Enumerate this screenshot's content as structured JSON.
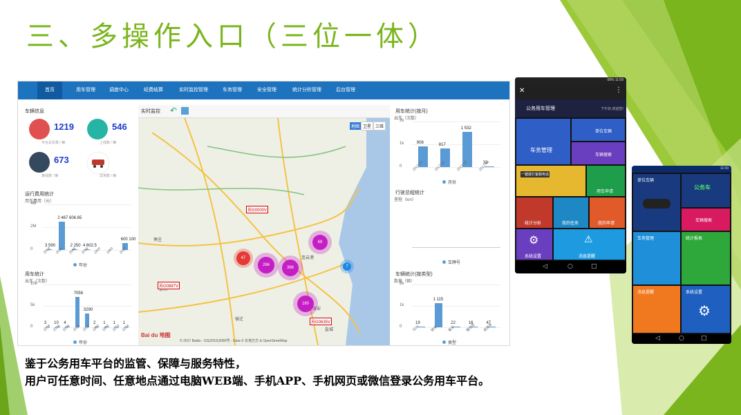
{
  "title": "三、多操作入口（三位一体）",
  "caption": {
    "line1": "鉴于公务用车平台的监管、保障与服务特性，",
    "line2": "用户可任意时间、任意地点通过电脑WEB端、手机APP、手机网页或微信登录公务用车平台。"
  },
  "colors": {
    "accent": "#7ab51d",
    "nav": "#1e73be",
    "bar": "#5b9bd5"
  },
  "web": {
    "nav": [
      "首页",
      "用车管理",
      "调度中心",
      "经费结算",
      "实时监控管理",
      "车务管理",
      "安全管理",
      "统计分析管理",
      "后台管理"
    ],
    "vehicle_info": {
      "title": "车辆信息",
      "stats": [
        {
          "value": "1219",
          "label": "平台总车数 / 辆",
          "icon": "red-car-icon",
          "color": "#e05050"
        },
        {
          "value": "546",
          "label": "上线数 / 辆",
          "icon": "teal-car-icon",
          "color": "#26b5a5"
        },
        {
          "value": "673",
          "label": "离线数 / 辆",
          "icon": "dark-car-icon",
          "color": "#34495e"
        },
        {
          "value": "",
          "label": "异常数 / 辆",
          "icon": "crash-car-icon",
          "color": "#c0392b"
        }
      ]
    },
    "cost_chart_title": "运行费用统计",
    "usage_chart_title": "用车统计",
    "monthly_chart_title": "用车统计(按月)",
    "mileage_chart_title": "行驶总程统计",
    "type_chart_title": "车辆统计(按类型)",
    "map": {
      "title": "实时监控",
      "mode_buttons": [
        "地图",
        "卫星",
        "三维"
      ],
      "clusters": [
        {
          "label": "47"
        },
        {
          "label": "266"
        },
        {
          "label": "366"
        },
        {
          "label": "69"
        },
        {
          "label": "160"
        },
        {
          "label": "7"
        }
      ],
      "plates": [
        "苏G0000V",
        "苏G0887V",
        "苏G0635V"
      ],
      "places": [
        "枣庄",
        "宿迁",
        "徐州",
        "淮安",
        "盐城",
        "连云港"
      ],
      "logo": "Bai du 地图",
      "copyright": "© 2017 Baidu - GS(2016)2089号 - Data © 长地万方 & OpenStreetMap"
    }
  },
  "chart_data": [
    {
      "type": "bar",
      "title": "运行费用统计",
      "ylabel": "用车费用（元）",
      "categories": [
        "2018",
        "2016",
        "2006",
        "2016",
        "1900",
        "1990",
        "2013"
      ],
      "values": [
        3590,
        2467606.65,
        2250,
        4602.5,
        0,
        0,
        600100
      ],
      "data_labels": [
        "3 590",
        "2 467 606.65",
        "2 250",
        "4 602.5",
        "",
        "",
        "600 100"
      ],
      "yticks": [
        "0",
        "2M",
        "4M"
      ],
      "ylim": [
        0,
        4000000
      ],
      "legend": "年份"
    },
    {
      "type": "bar",
      "title": "用车统计",
      "ylabel": "出车（次数）",
      "categories": [
        "2018",
        "2016",
        "2006",
        "2016",
        "2017",
        "1900",
        "1990",
        "2013",
        "2014"
      ],
      "values": [
        3,
        10,
        4,
        7058,
        3290,
        2,
        1,
        1,
        1
      ],
      "yticks": [
        "0",
        "5k",
        "10k"
      ],
      "ylim": [
        0,
        10000
      ],
      "legend": "年份"
    },
    {
      "type": "bar",
      "title": "用车统计(按月)",
      "ylabel": "出车（次数）",
      "categories": [
        "2017-01",
        "2017-02",
        "2017-03",
        "2017-04"
      ],
      "values": [
        908,
        817,
        1532,
        33
      ],
      "data_labels": [
        "908",
        "817",
        "1 532",
        "33"
      ],
      "yticks": [
        "0",
        "1k",
        "2k"
      ],
      "ylim": [
        0,
        2000
      ],
      "legend": "月份"
    },
    {
      "type": "bar",
      "title": "行驶总程统计",
      "ylabel": "里程（km）",
      "categories": [],
      "values": [],
      "legend": "车牌号"
    },
    {
      "type": "bar",
      "title": "车辆统计(按类型)",
      "ylabel": "数量（辆）",
      "categories": [
        "SUV",
        "轿车",
        "客车",
        "面包车",
        "商务车"
      ],
      "values": [
        19,
        1115,
        22,
        16,
        47
      ],
      "data_labels": [
        "19",
        "1 115",
        "22",
        "16",
        "47"
      ],
      "yticks": [
        "0",
        "1k",
        "2k"
      ],
      "ylim": [
        0,
        2000
      ],
      "legend": "类型"
    }
  ],
  "phone1": {
    "status": "08% 11:09",
    "app_title": "公务用车管理",
    "greeting": "下午好,欢迎您!",
    "tiles": [
      "车务管理",
      "单位车辆",
      "车辆搜索",
      "用车申请",
      "统计分析",
      "我的任务",
      "我的申请",
      "系统设置",
      "消息提醒"
    ],
    "banner": "一键拨打客服电话"
  },
  "phone2": {
    "status": "11:09",
    "logo": "公务车",
    "tiles": [
      "单位车辆",
      "车辆搜索",
      "车务管理",
      "统计报表",
      "消息提醒",
      "系统设置"
    ]
  }
}
